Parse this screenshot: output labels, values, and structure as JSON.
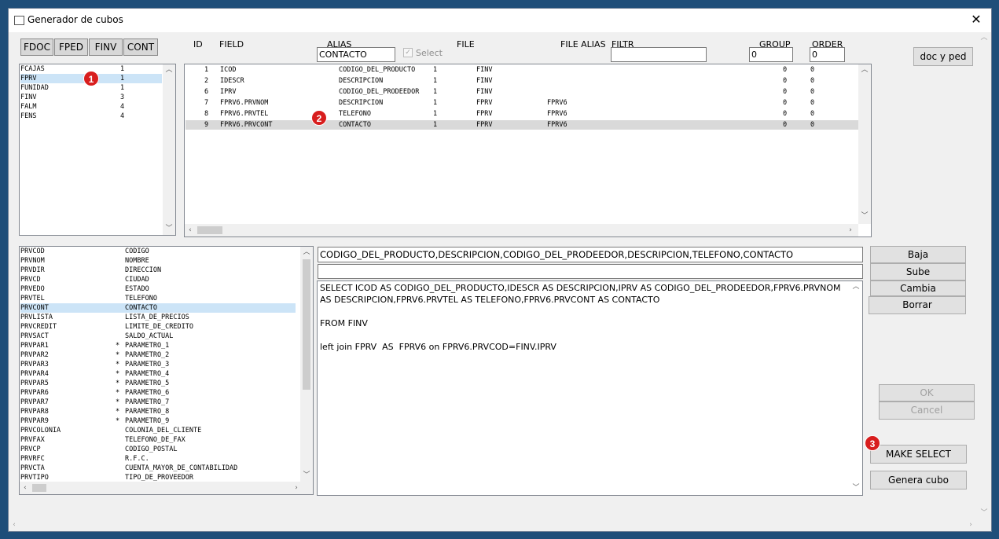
{
  "window": {
    "title": "Generador de cubos"
  },
  "tabs": [
    "FDOC",
    "FPED",
    "FINV",
    "CONT"
  ],
  "headers": {
    "id": "ID",
    "field": "FIELD",
    "alias": "ALIAS",
    "file": "FILE",
    "file_alias": "FILE ALIAS",
    "filtr": "FILTR",
    "group": "GROUP",
    "order": "ORDER"
  },
  "inputs": {
    "alias": "CONTACTO",
    "select_label": "Select",
    "filtr": "",
    "group": "0",
    "order": "0"
  },
  "doc_ped_button": "doc y ped",
  "file_list": [
    {
      "name": "FCAJAS",
      "count": "1"
    },
    {
      "name": "FPRV",
      "count": "1"
    },
    {
      "name": "FUNIDAD",
      "count": "1"
    },
    {
      "name": "FINV",
      "count": "3"
    },
    {
      "name": "FALM",
      "count": "4"
    },
    {
      "name": "FENS",
      "count": "4"
    }
  ],
  "fields_grid": [
    {
      "id": "1",
      "field": "ICOD",
      "alias": "CODIGO_DEL_PRODUCTO",
      "n": "1",
      "file": "FINV",
      "file_alias": "",
      "group": "0",
      "order": "0"
    },
    {
      "id": "2",
      "field": "IDESCR",
      "alias": "DESCRIPCION",
      "n": "1",
      "file": "FINV",
      "file_alias": "",
      "group": "0",
      "order": "0"
    },
    {
      "id": "6",
      "field": "IPRV",
      "alias": "CODIGO_DEL_PRODEEDOR",
      "n": "1",
      "file": "FINV",
      "file_alias": "",
      "group": "0",
      "order": "0"
    },
    {
      "id": "7",
      "field": "FPRV6.PRVNOM",
      "alias": "DESCRIPCION",
      "n": "1",
      "file": "FPRV",
      "file_alias": "FPRV6",
      "group": "0",
      "order": "0"
    },
    {
      "id": "8",
      "field": "FPRV6.PRVTEL",
      "alias": "TELEFONO",
      "n": "1",
      "file": "FPRV",
      "file_alias": "FPRV6",
      "group": "0",
      "order": "0"
    },
    {
      "id": "9",
      "field": "FPRV6.PRVCONT",
      "alias": "CONTACTO",
      "n": "1",
      "file": "FPRV",
      "file_alias": "FPRV6",
      "group": "0",
      "order": "0"
    }
  ],
  "column_list": [
    {
      "code": "PRVCOD",
      "flag": "",
      "desc": "CODIGO"
    },
    {
      "code": "PRVNOM",
      "flag": "",
      "desc": "NOMBRE"
    },
    {
      "code": "PRVDIR",
      "flag": "",
      "desc": "DIRECCION"
    },
    {
      "code": "PRVCD",
      "flag": "",
      "desc": "CIUDAD"
    },
    {
      "code": "PRVEDO",
      "flag": "",
      "desc": "ESTADO"
    },
    {
      "code": "PRVTEL",
      "flag": "",
      "desc": "TELEFONO"
    },
    {
      "code": "PRVCONT",
      "flag": "",
      "desc": "CONTACTO"
    },
    {
      "code": "PRVLISTA",
      "flag": "",
      "desc": "LISTA_DE_PRECIOS"
    },
    {
      "code": "PRVCREDIT",
      "flag": "",
      "desc": "LIMITE_DE_CREDITO"
    },
    {
      "code": "PRVSACT",
      "flag": "",
      "desc": "SALDO_ACTUAL"
    },
    {
      "code": "PRVPAR1",
      "flag": "*",
      "desc": "PARAMETRO_1"
    },
    {
      "code": "PRVPAR2",
      "flag": "*",
      "desc": "PARAMETRO_2"
    },
    {
      "code": "PRVPAR3",
      "flag": "*",
      "desc": "PARAMETRO_3"
    },
    {
      "code": "PRVPAR4",
      "flag": "*",
      "desc": "PARAMETRO_4"
    },
    {
      "code": "PRVPAR5",
      "flag": "*",
      "desc": "PARAMETRO_5"
    },
    {
      "code": "PRVPAR6",
      "flag": "*",
      "desc": "PARAMETRO_6"
    },
    {
      "code": "PRVPAR7",
      "flag": "*",
      "desc": "PARAMETRO_7"
    },
    {
      "code": "PRVPAR8",
      "flag": "*",
      "desc": "PARAMETRO_8"
    },
    {
      "code": "PRVPAR9",
      "flag": "*",
      "desc": "PARAMETRO_9"
    },
    {
      "code": "PRVCOLONIA",
      "flag": "",
      "desc": "COLONIA_DEL_CLIENTE"
    },
    {
      "code": "PRVFAX",
      "flag": "",
      "desc": "TELEFONO_DE_FAX"
    },
    {
      "code": "PRVCP",
      "flag": "",
      "desc": "CODIGO_POSTAL"
    },
    {
      "code": "PRVRFC",
      "flag": "",
      "desc": "R.F.C."
    },
    {
      "code": "PRVCTA",
      "flag": "",
      "desc": "CUENTA_MAYOR_DE_CONTABILIDAD"
    },
    {
      "code": "PRVTIPO",
      "flag": "",
      "desc": "TIPO_DE_PROVEEDOR"
    }
  ],
  "aliases_line": "CODIGO_DEL_PRODUCTO,DESCRIPCION,CODIGO_DEL_PRODEEDOR,DESCRIPCION,TELEFONO,CONTACTO",
  "second_line": "",
  "sql_text": "SELECT ICOD AS CODIGO_DEL_PRODUCTO,IDESCR AS DESCRIPCION,IPRV AS CODIGO_DEL_PRODEEDOR,FPRV6.PRVNOM AS DESCRIPCION,FPRV6.PRVTEL AS TELEFONO,FPRV6.PRVCONT AS CONTACTO\n\nFROM FINV\n\nleft join FPRV  AS  FPRV6 on FPRV6.PRVCOD=FINV.IPRV",
  "buttons": {
    "baja": "Baja",
    "sube": "Sube",
    "cambia": "Cambia",
    "borrar": "Borrar",
    "ok": "OK",
    "cancel": "Cancel",
    "make_select": "MAKE SELECT",
    "genera_cubo": "Genera cubo"
  },
  "badges": [
    "1",
    "2",
    "3"
  ],
  "colors": {
    "badge": "#d81e1e",
    "selection": "#cce4f7",
    "frame": "#1f4e79"
  }
}
